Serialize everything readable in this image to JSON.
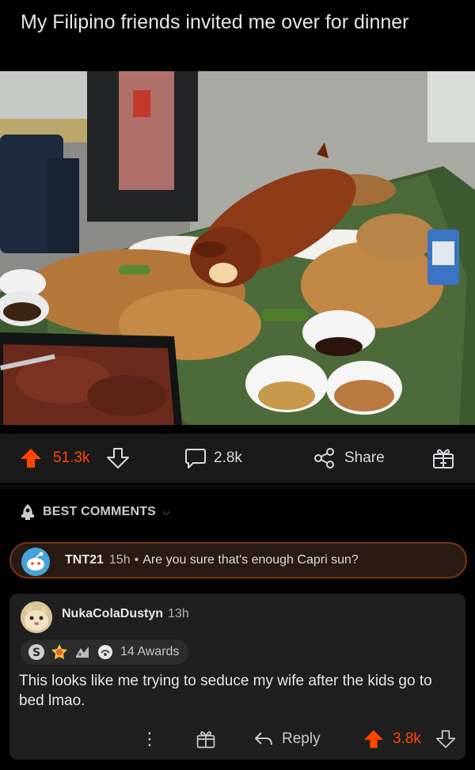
{
  "post": {
    "title": "My Filipino friends invited me over for dinner",
    "upvotes": "51.3k",
    "comments": "2.8k",
    "share_label": "Share"
  },
  "sort": {
    "label": "BEST COMMENTS"
  },
  "pinned_comment": {
    "username": "TNT21",
    "time": "15h",
    "separator": "•",
    "text": "Are you sure that's enough Capri sun?"
  },
  "comment": {
    "username": "NukaColaDustyn",
    "time": "13h",
    "awards_label": "14 Awards",
    "body": "This looks like me trying to seduce my wife after the kids go to bed lmao.",
    "reply_label": "Reply",
    "votes": "3.8k"
  },
  "colors": {
    "upvote_active": "#ff4500",
    "background": "#000000",
    "card": "#1f1f1f",
    "pinned_border": "#7a3413"
  },
  "icons": [
    "upvote-icon",
    "downvote-icon",
    "comment-icon",
    "share-icon",
    "award-icon",
    "rocket-icon",
    "chevron-down-icon",
    "more-icon",
    "reply-icon"
  ]
}
